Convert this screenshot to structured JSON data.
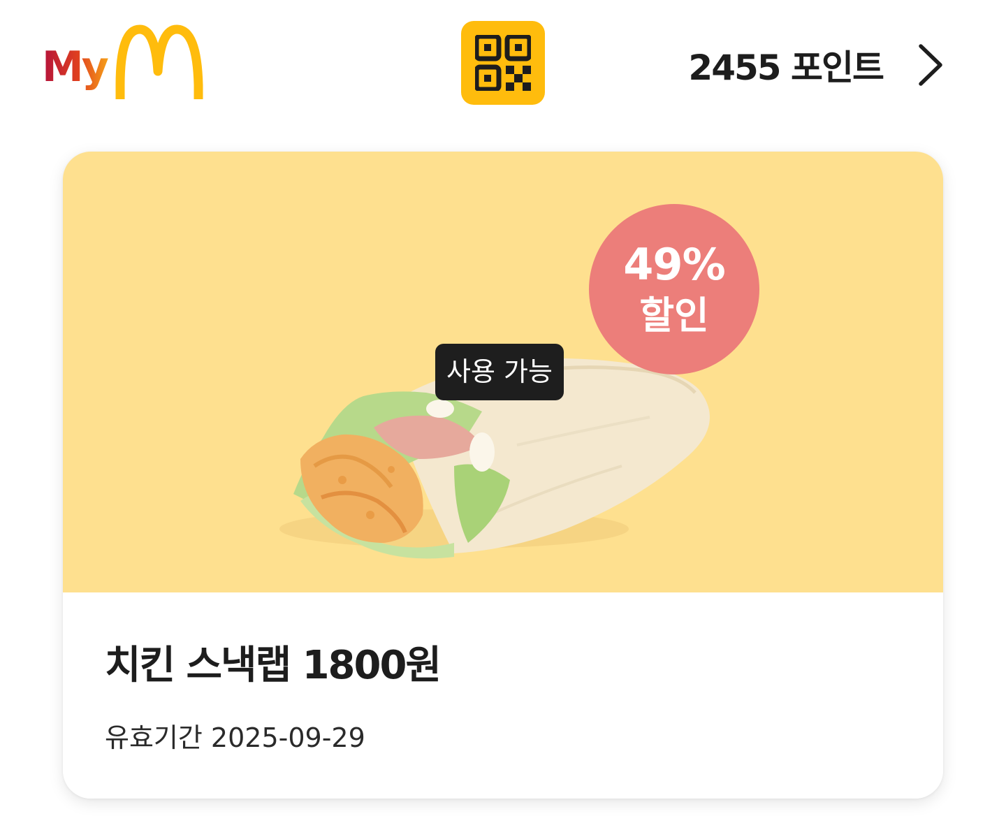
{
  "header": {
    "logo": {
      "my_text": "My",
      "icon": "golden-arches-logo",
      "colors": {
        "my_start": "#c8102e",
        "my_end": "#ffbc0d",
        "arches": "#ffbc0d"
      }
    },
    "qr_button": {
      "icon": "qr-code-icon",
      "background": "#ffbc0d"
    },
    "points": {
      "label": "2455 포인트",
      "icon": "chevron-right-icon"
    }
  },
  "coupon": {
    "image_background": "#fee08f",
    "discount": {
      "percent": "49%",
      "label": "할인",
      "color": "#ec7e7a"
    },
    "status": "사용 가능",
    "image_subject": "chicken-snack-wrap",
    "title": "치킨 스낵랩 1800원",
    "expiry": "유효기간 2025-09-29"
  }
}
